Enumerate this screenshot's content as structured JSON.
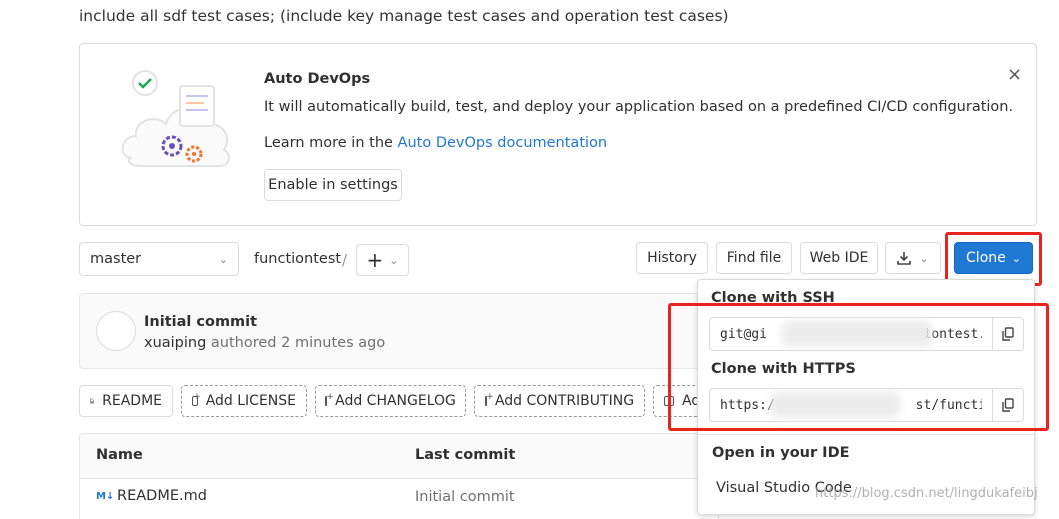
{
  "description": "include all sdf test cases; (include key manage test cases and operation test cases)",
  "auto_devops": {
    "title": "Auto DevOps",
    "text": "It will automatically build, test, and deploy your application based on a predefined CI/CD configuration.",
    "learn_prefix": "Learn more in the ",
    "learn_link": "Auto DevOps documentation",
    "button": "Enable in settings",
    "close": "×"
  },
  "toolbar": {
    "branch": "master",
    "project": "functiontest",
    "separator": "/",
    "plus": "+",
    "history": "History",
    "find_file": "Find file",
    "web_ide": "Web IDE",
    "clone": "Clone"
  },
  "commit": {
    "title": "Initial commit",
    "author": "xuaiping",
    "authored": " authored 2 minutes ago"
  },
  "actions": {
    "readme": "README",
    "license": "Add LICENSE",
    "changelog": "Add CHANGELOG",
    "contributing": "Add CONTRIBUTING",
    "more": "Ad"
  },
  "table": {
    "headers": {
      "name": "Name",
      "last_commit": "Last commit"
    },
    "rows": [
      {
        "icon": "M↓",
        "name": "README.md",
        "last_commit": "Initial commit"
      }
    ]
  },
  "clone_dropdown": {
    "ssh_title": "Clone with SSH",
    "ssh_value": "git@gi                    iontest.git",
    "https_title": "Clone with HTTPS",
    "https_value": "https:/                  st/functiontest",
    "ide_title": "Open in your IDE",
    "ide_option": "Visual Studio Code"
  },
  "watermark": "https://blog.csdn.net/lingdukafeibj",
  "colors": {
    "accent": "#1f78d1",
    "highlight": "#e8251d"
  },
  "icons": [
    "check-circle-icon",
    "gear-icon",
    "close-icon",
    "chevron-down-icon",
    "plus-icon",
    "download-icon",
    "copy-icon",
    "file-icon",
    "markdown-icon"
  ]
}
